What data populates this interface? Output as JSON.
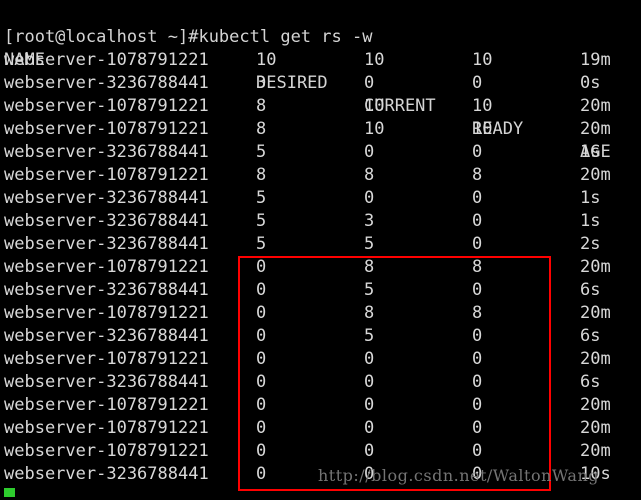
{
  "terminal": {
    "prompt": "[root@localhost ~]#kubectl get rs -w",
    "cursor_color": "#2ecc2e",
    "background_color": "#000000",
    "text_color": "#d8d8d8"
  },
  "table": {
    "headers": {
      "name": "NAME",
      "desired": "DESIRED",
      "current": "CURRENT",
      "ready": "READY",
      "age": "AGE"
    },
    "rows": [
      {
        "name": "webserver-1078791221",
        "desired": "10",
        "current": "10",
        "ready": "10",
        "age": "19m"
      },
      {
        "name": "webserver-3236788441",
        "desired": "3",
        "current": "0",
        "ready": "0",
        "age": "0s"
      },
      {
        "name": "webserver-1078791221",
        "desired": "8",
        "current": "10",
        "ready": "10",
        "age": "20m"
      },
      {
        "name": "webserver-1078791221",
        "desired": "8",
        "current": "10",
        "ready": "10",
        "age": "20m"
      },
      {
        "name": "webserver-3236788441",
        "desired": "5",
        "current": "0",
        "ready": "0",
        "age": "1s"
      },
      {
        "name": "webserver-1078791221",
        "desired": "8",
        "current": "8",
        "ready": "8",
        "age": "20m"
      },
      {
        "name": "webserver-3236788441",
        "desired": "5",
        "current": "0",
        "ready": "0",
        "age": "1s"
      },
      {
        "name": "webserver-3236788441",
        "desired": "5",
        "current": "3",
        "ready": "0",
        "age": "1s"
      },
      {
        "name": "webserver-3236788441",
        "desired": "5",
        "current": "5",
        "ready": "0",
        "age": "2s"
      },
      {
        "name": "webserver-1078791221",
        "desired": "0",
        "current": "8",
        "ready": "8",
        "age": "20m"
      },
      {
        "name": "webserver-3236788441",
        "desired": "0",
        "current": "5",
        "ready": "0",
        "age": "6s"
      },
      {
        "name": "webserver-1078791221",
        "desired": "0",
        "current": "8",
        "ready": "8",
        "age": "20m"
      },
      {
        "name": "webserver-3236788441",
        "desired": "0",
        "current": "5",
        "ready": "0",
        "age": "6s"
      },
      {
        "name": "webserver-1078791221",
        "desired": "0",
        "current": "0",
        "ready": "0",
        "age": "20m"
      },
      {
        "name": "webserver-3236788441",
        "desired": "0",
        "current": "0",
        "ready": "0",
        "age": "6s"
      },
      {
        "name": "webserver-1078791221",
        "desired": "0",
        "current": "0",
        "ready": "0",
        "age": "20m"
      },
      {
        "name": "webserver-1078791221",
        "desired": "0",
        "current": "0",
        "ready": "0",
        "age": "20m"
      },
      {
        "name": "webserver-1078791221",
        "desired": "0",
        "current": "0",
        "ready": "0",
        "age": "20m"
      },
      {
        "name": "webserver-3236788441",
        "desired": "0",
        "current": "0",
        "ready": "0",
        "age": "10s"
      }
    ]
  },
  "annotation": {
    "highlight_box_color": "#ff0000"
  },
  "watermark": {
    "text": "http://blog.csdn.net/WaltonWang"
  }
}
